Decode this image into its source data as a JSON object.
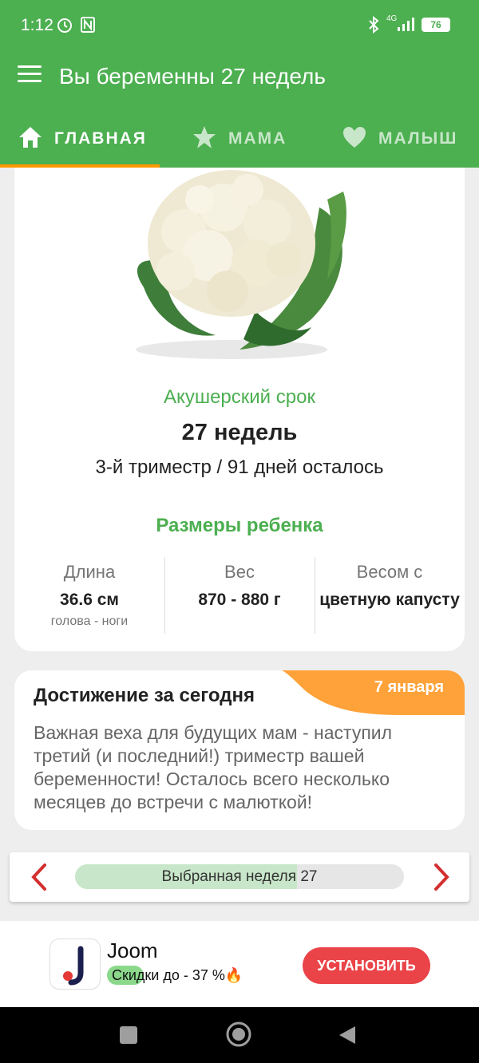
{
  "status_bar": {
    "time": "1:12",
    "battery": "76",
    "network": "4G"
  },
  "app_bar": {
    "title": "Вы беременны 27 недель"
  },
  "tabs": [
    {
      "label": "ГЛАВНАЯ",
      "icon": "home-icon",
      "active": true
    },
    {
      "label": "МАМА",
      "icon": "star-icon",
      "active": false
    },
    {
      "label": "МАЛЫШ",
      "icon": "heart-icon",
      "active": false
    }
  ],
  "main": {
    "obstetric_label": "Акушерский срок",
    "weeks": "27 недель",
    "trimester_info": "3-й триместр / 91 дней осталось",
    "sizes_title": "Размеры ребенка",
    "sizes": [
      {
        "label": "Длина",
        "value": "36.6 см",
        "sub": "голова - ноги"
      },
      {
        "label": "Вес",
        "value": "870 - 880 г",
        "sub": ""
      },
      {
        "label": "Весом с",
        "value": "цветную капусту",
        "sub": ""
      }
    ]
  },
  "achievement": {
    "title": "Достижение за сегодня",
    "date": "7 января",
    "text": "Важная веха для будущих мам - наступил третий (и последний!) триместр вашей беременности! Осталось всего несколько месяцев до встречи с малюткой!"
  },
  "week_selector": {
    "label": "Выбранная неделя 27",
    "progress": 0.675
  },
  "ad": {
    "app_name": "Joom",
    "subtitle": "Скидки до -  37  %🔥",
    "install_label": "УСТАНОВИТЬ"
  },
  "colors": {
    "primary": "#4caf50",
    "accent": "#ff9800",
    "arrow": "#d32f2f",
    "install": "#ea4448"
  }
}
